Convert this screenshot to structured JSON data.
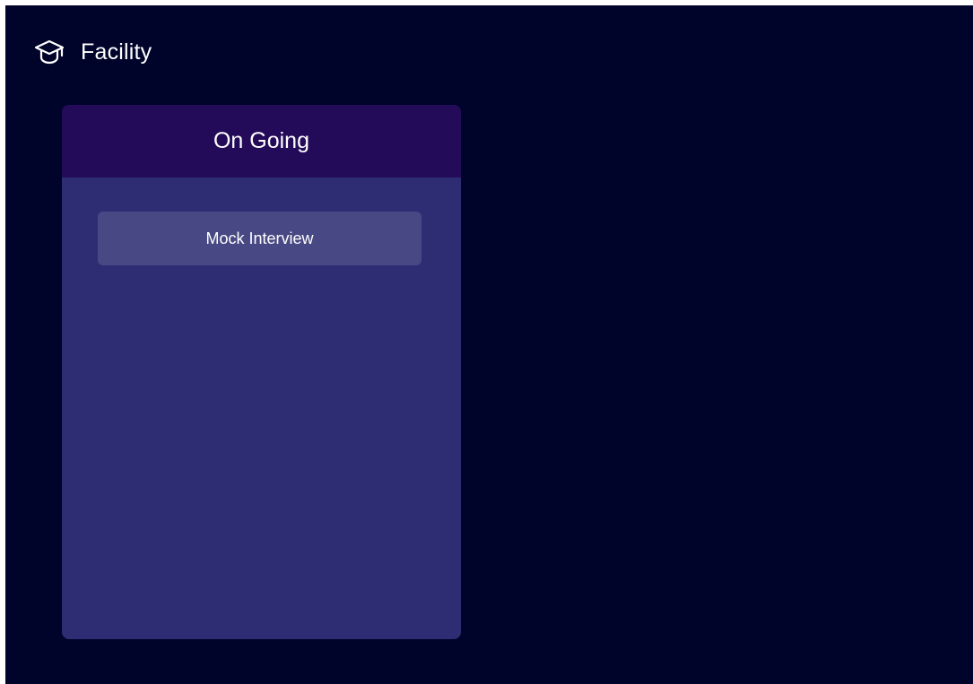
{
  "header": {
    "icon": "graduation-cap-icon",
    "title": "Facility"
  },
  "column": {
    "title": "On Going",
    "items": [
      {
        "label": "Mock Interview"
      }
    ]
  },
  "colors": {
    "background": "#00032a",
    "panel": "#2e2d74",
    "panel_header": "#240b5a",
    "card": "#484884",
    "text": "#ffffff"
  }
}
